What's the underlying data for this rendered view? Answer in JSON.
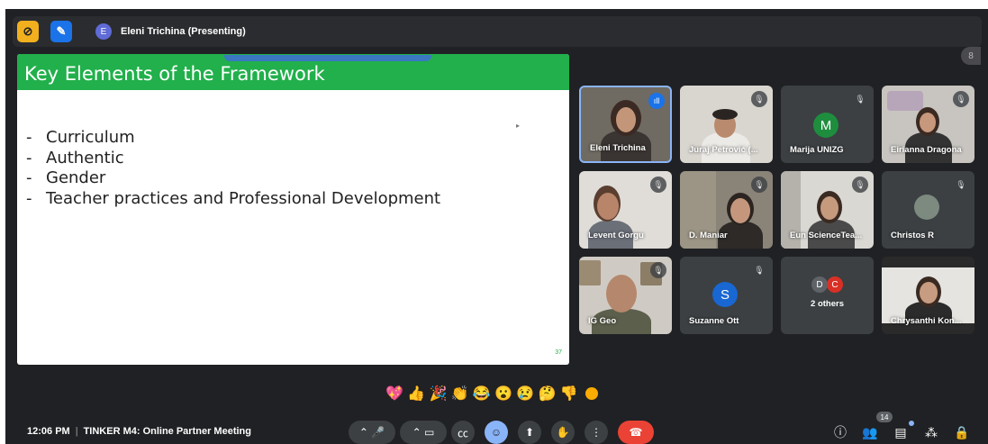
{
  "top_bar": {
    "presenter_initial": "E",
    "presenter_label": "Eleni Trichina (Presenting)",
    "corner_badge": "8"
  },
  "slide": {
    "title": "Key Elements of the Framework",
    "bullets": [
      "Curriculum",
      "Authentic",
      "Gender",
      "Teacher practices and Professional Development"
    ],
    "page_number": "37"
  },
  "participants": [
    {
      "name": "Eleni Trichina",
      "type": "video",
      "status": "speaking"
    },
    {
      "name": "Juraj Petrović (...",
      "type": "video",
      "status": "muted"
    },
    {
      "name": "Marija UNIZG",
      "type": "avatar",
      "initial": "M",
      "avatar_color": "#1e8e3e",
      "status": "muted"
    },
    {
      "name": "Eirianna Dragona",
      "type": "video",
      "status": "muted"
    },
    {
      "name": "Levent Gorgu",
      "type": "video",
      "status": "muted"
    },
    {
      "name": "D. Maniar",
      "type": "video",
      "status": "muted"
    },
    {
      "name": "Eun ScienceTea...",
      "type": "video",
      "status": "muted"
    },
    {
      "name": "Christos R",
      "type": "video",
      "status": "muted"
    },
    {
      "name": "IG Geo",
      "type": "video",
      "status": "muted"
    },
    {
      "name": "Suzanne Ott",
      "type": "avatar",
      "initial": "S",
      "avatar_color": "#1967d2",
      "status": "muted"
    },
    {
      "name": "2 others",
      "type": "group",
      "initials": [
        "D",
        "C"
      ],
      "avatar_colors": [
        "#5f6368",
        "#d93025"
      ]
    },
    {
      "name": "Chrysanthi Kon...",
      "type": "video",
      "status": "none"
    }
  ],
  "reactions": [
    "💖",
    "👍",
    "🎉",
    "👏",
    "😂",
    "😮",
    "😢",
    "🤔",
    "👎"
  ],
  "bottom_bar": {
    "time": "12:06 PM",
    "meeting_title": "TINKER M4: Online Partner Meeting",
    "people_count": "14"
  },
  "colors": {
    "background": "#202124",
    "slide_header": "#21b04b",
    "end_call": "#ea4335",
    "accent": "#8ab4f8"
  }
}
